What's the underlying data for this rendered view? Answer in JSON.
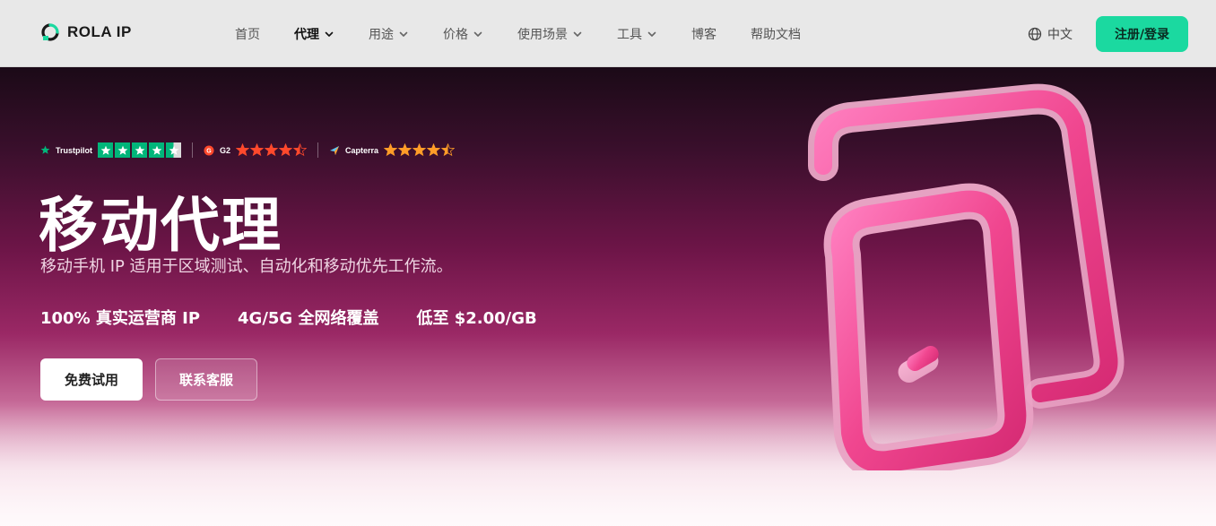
{
  "brand": {
    "name": "ROLA IP",
    "accent": "#1bd9a0"
  },
  "nav": {
    "items": [
      {
        "label": "首页",
        "dropdown": false,
        "active": false
      },
      {
        "label": "代理",
        "dropdown": true,
        "active": true
      },
      {
        "label": "用途",
        "dropdown": true,
        "active": false
      },
      {
        "label": "价格",
        "dropdown": true,
        "active": false
      },
      {
        "label": "使用场景",
        "dropdown": true,
        "active": false
      },
      {
        "label": "工具",
        "dropdown": true,
        "active": false
      },
      {
        "label": "博客",
        "dropdown": false,
        "active": false
      },
      {
        "label": "帮助文档",
        "dropdown": false,
        "active": false
      }
    ],
    "language": "中文",
    "signup_label": "注册/登录"
  },
  "hero": {
    "ratings": [
      {
        "name": "Trustpilot",
        "icon": "trustpilot-star-icon",
        "rating": 4.5,
        "color": "#00b67a"
      },
      {
        "name": "G2",
        "icon": "g2-logo-icon",
        "rating": 4.5,
        "color": "#ff492c"
      },
      {
        "name": "Capterra",
        "icon": "capterra-logo-icon",
        "rating": 4.5,
        "color": "#ff9d28"
      }
    ],
    "title": "移动代理",
    "subtitle": "移动手机 IP 适用于区域测试、自动化和移动优先工作流。",
    "features": [
      "100% 真实运营商 IP",
      "4G/5G 全网络覆盖",
      "低至 $2.00/GB"
    ],
    "primary_button": "免费试用",
    "secondary_button": "联系客服",
    "illustration": "mobile-phone-icon"
  }
}
